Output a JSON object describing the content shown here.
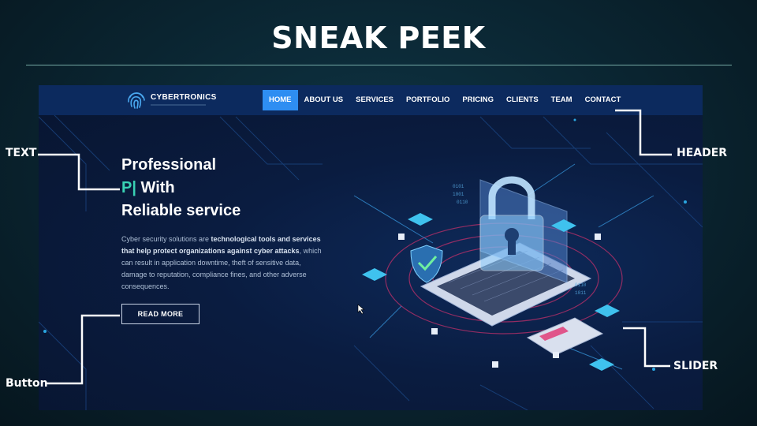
{
  "slide": {
    "title": "SNEAK PEEK"
  },
  "site": {
    "brand": "CYBERTRONICS",
    "nav": [
      {
        "label": "HOME",
        "active": true
      },
      {
        "label": "ABOUT US"
      },
      {
        "label": "SERVICES"
      },
      {
        "label": "PORTFOLIO"
      },
      {
        "label": "PRICING"
      },
      {
        "label": "CLIENTS"
      },
      {
        "label": "TEAM"
      },
      {
        "label": "CONTACT"
      }
    ],
    "hero": {
      "line1": "Professional",
      "typed": "P|",
      "line2_rest": " With",
      "line3": "Reliable service",
      "desc_start": "Cyber security solutions are ",
      "desc_bold": "technological tools and services that help protect organizations against cyber attacks",
      "desc_end": ", which can result in application downtime, theft of sensitive data, damage to reputation, compliance fines, and other adverse consequences.",
      "button": "READ MORE"
    }
  },
  "callouts": {
    "text": "TEXT",
    "header": "HEADER",
    "button": "Button",
    "slider": "SLIDER"
  },
  "colors": {
    "accent": "#39d2b4",
    "nav_active": "#2e8ef2",
    "nav_bg": "#0c2a5e"
  }
}
